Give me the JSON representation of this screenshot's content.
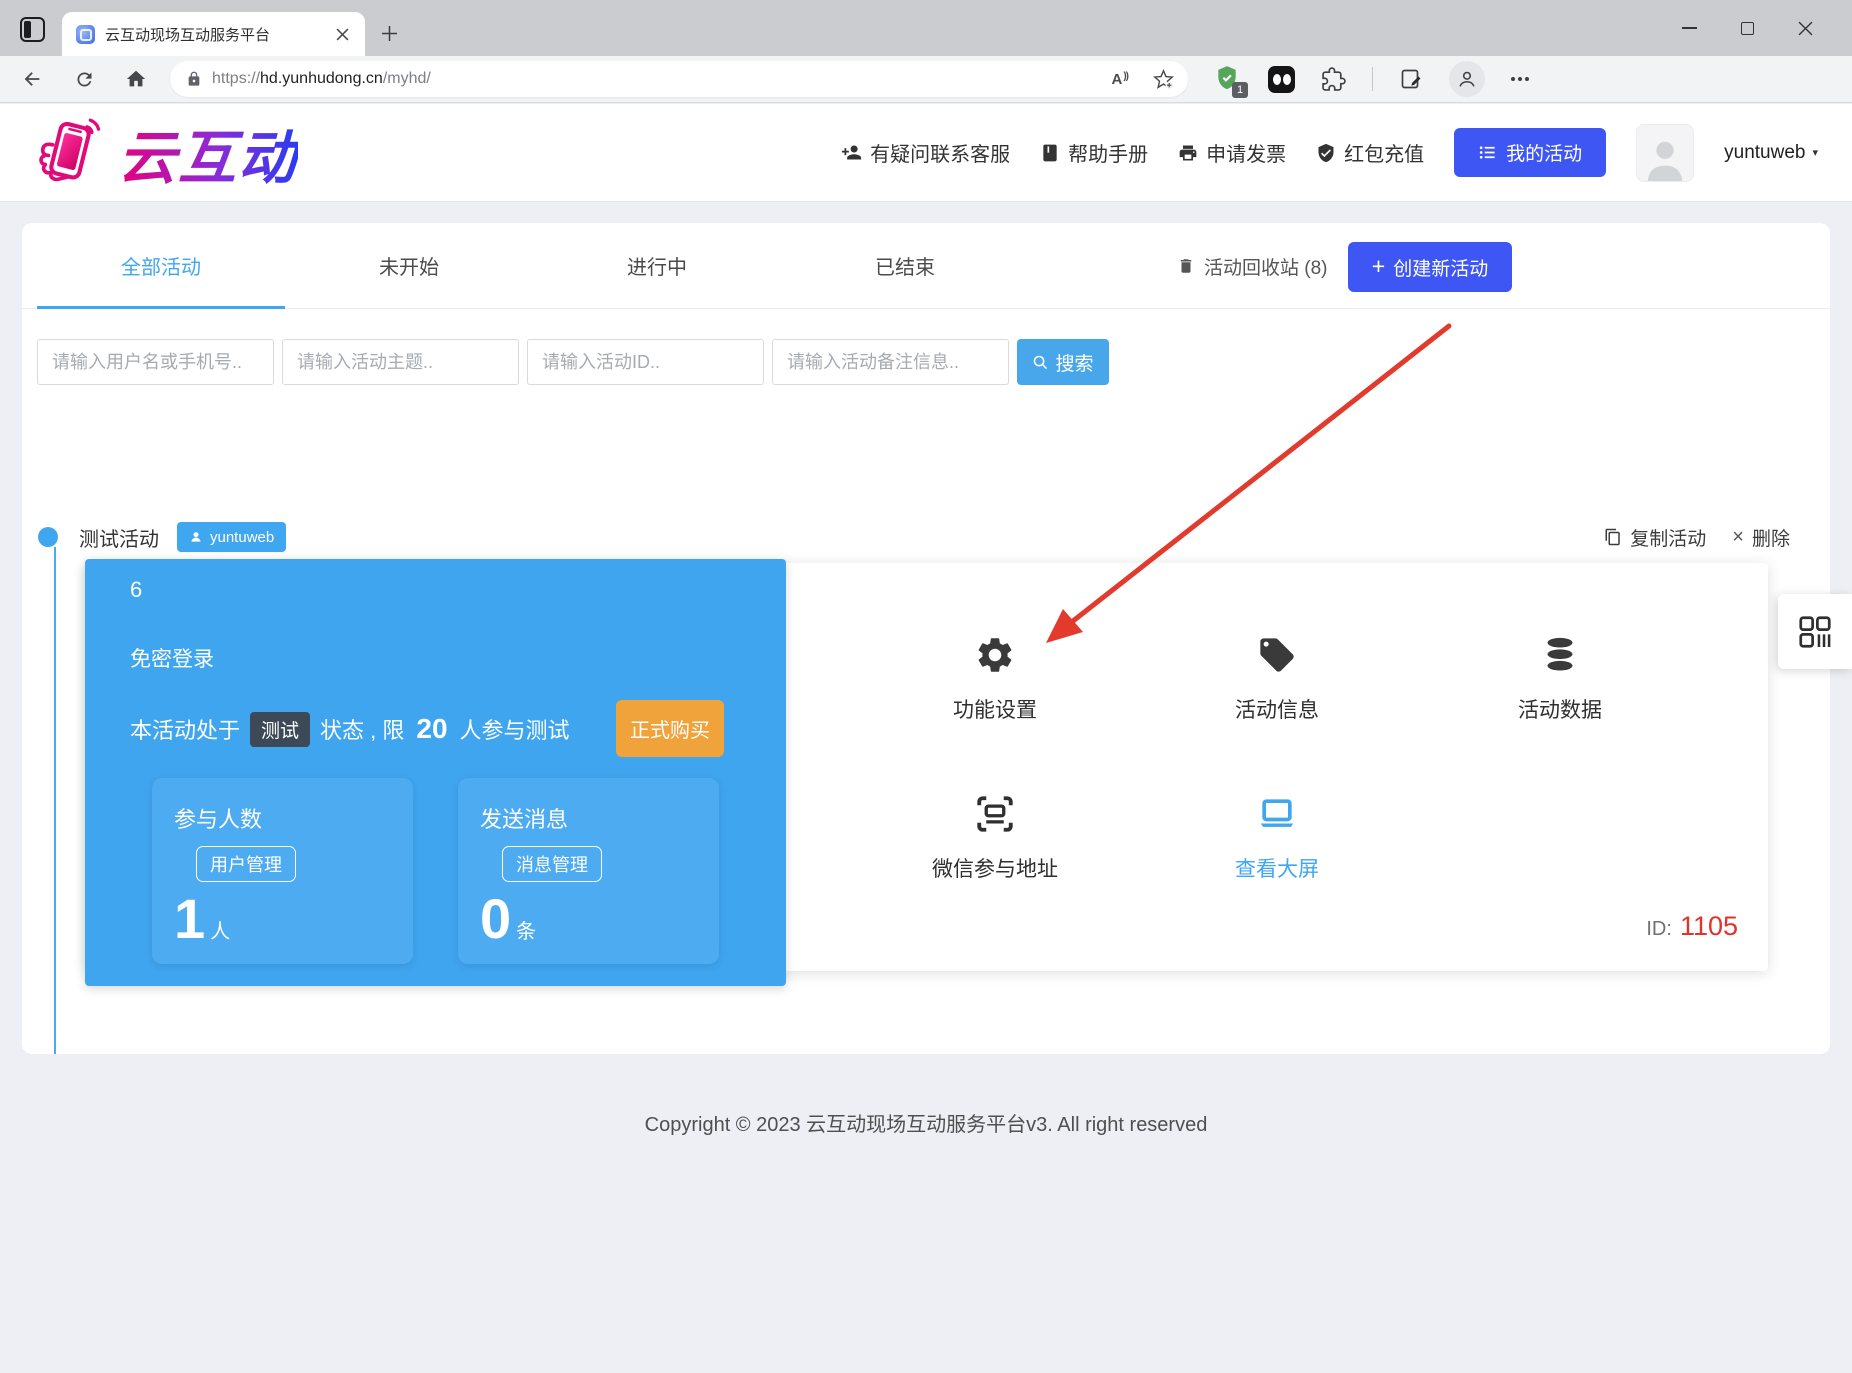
{
  "window": {
    "tab_title": "云互动现场互动服务平台"
  },
  "browser": {
    "url_scheme": "https://",
    "url_host": "hd.yunhudong.cn",
    "url_path": "/myhd/",
    "shield_badge": "1"
  },
  "glyphs": {
    "read_aloud": "A",
    "read_aloud_marks": "))",
    "caret": "▾"
  },
  "header": {
    "logo_text": "云互动",
    "nav": [
      {
        "label": "有疑问联系客服",
        "icon": "person-add-icon"
      },
      {
        "label": "帮助手册",
        "icon": "book-icon"
      },
      {
        "label": "申请发票",
        "icon": "printer-icon"
      },
      {
        "label": "红包充值",
        "icon": "shield-check-icon"
      }
    ],
    "my_activities_label": "我的活动",
    "username": "yuntuweb"
  },
  "tabs": {
    "items": [
      {
        "label": "全部活动",
        "active": true
      },
      {
        "label": "未开始",
        "active": false
      },
      {
        "label": "进行中",
        "active": false
      },
      {
        "label": "已结束",
        "active": false
      }
    ],
    "recycle_label": "活动回收站 (8)",
    "create_plus": "+",
    "create_label": "创建新活动"
  },
  "search": {
    "user_placeholder": "请输入用户名或手机号..",
    "topic_placeholder": "请输入活动主题..",
    "id_placeholder": "请输入活动ID..",
    "note_placeholder": "请输入活动备注信息..",
    "button_label": "搜索"
  },
  "activity": {
    "title": "测试活动",
    "owner": "yuntuweb",
    "copy_label": "复制活动",
    "delete_x": "×",
    "delete_label": "删除",
    "card": {
      "corner_number": "6",
      "login_mode": "免密登录",
      "status_prefix": "本活动处于",
      "status_badge": "测试",
      "status_middle": "状态 , 限",
      "status_limit": "20",
      "status_suffix": "人参与测试",
      "buy_button": "正式购买",
      "stats": [
        {
          "title": "参与人数",
          "badge": "用户管理",
          "value": "1",
          "unit": "人"
        },
        {
          "title": "发送消息",
          "badge": "消息管理",
          "value": "0",
          "unit": "条"
        }
      ]
    },
    "features": [
      {
        "label": "功能设置",
        "icon": "gear-icon"
      },
      {
        "label": "活动信息",
        "icon": "tag-icon"
      },
      {
        "label": "活动数据",
        "icon": "database-icon"
      },
      {
        "label": "微信参与地址",
        "icon": "qr-scan-icon"
      },
      {
        "label": "查看大屏",
        "icon": "laptop-icon"
      }
    ],
    "id_label": "ID:",
    "id_value": "1105"
  },
  "footer": {
    "copyright": "Copyright © 2023 云互动现场互动服务平台v3. All right reserved"
  },
  "colors": {
    "primary_blue": "#3e56f4",
    "light_blue": "#3fa5ef",
    "orange": "#f1a33b",
    "red": "#e23229",
    "dark_badge": "#3d4956",
    "green_shield": "#57a55a"
  }
}
